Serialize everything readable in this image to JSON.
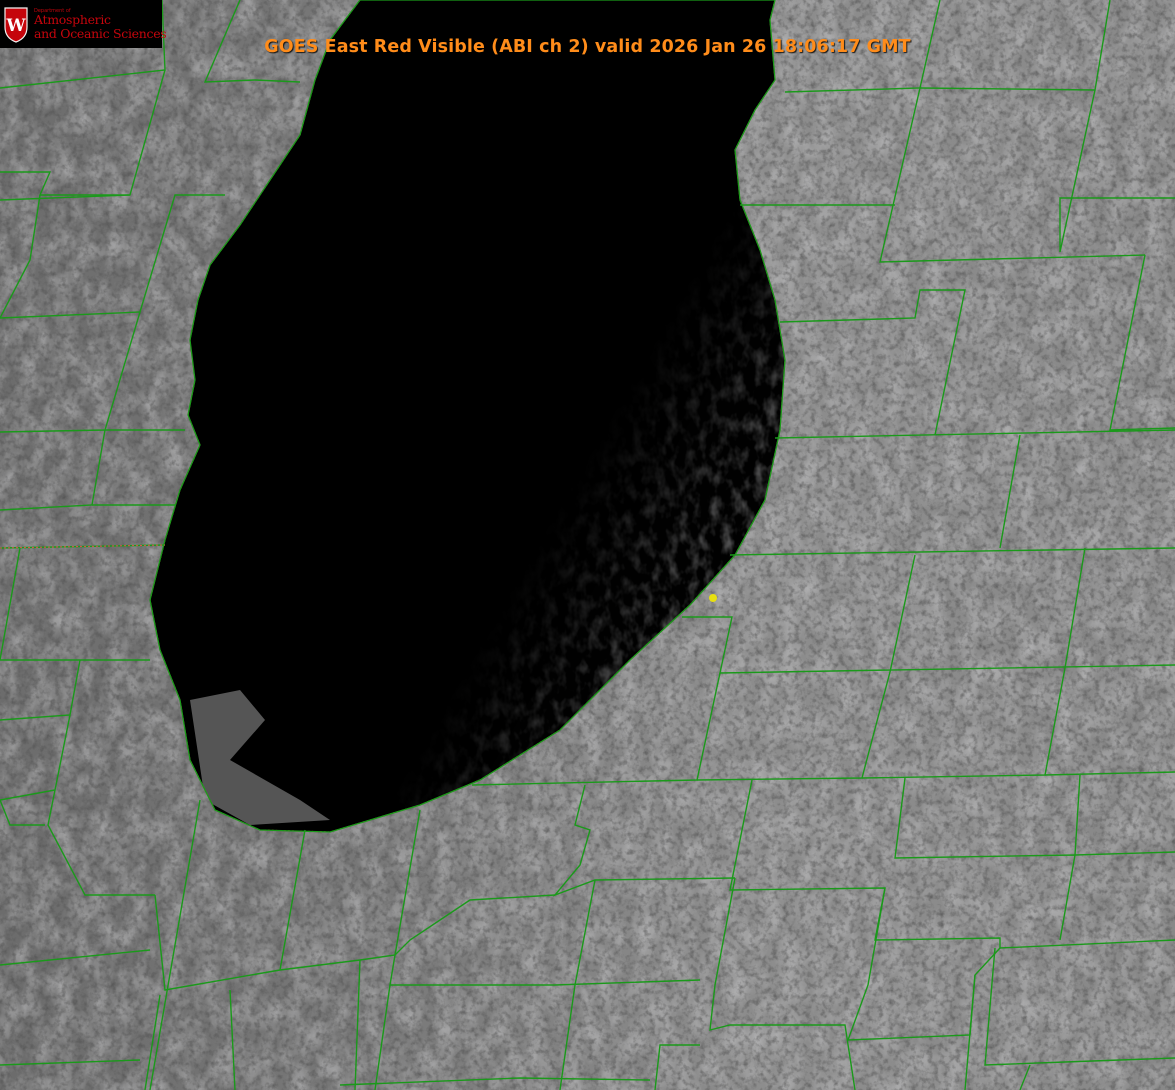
{
  "title": "GOES East Red Visible (ABI ch 2) valid 2026 Jan 26 18:06:17 GMT",
  "logo": {
    "department": "Department of",
    "line1": "Atmospheric",
    "line2": "and Oceanic Sciences",
    "crest_letter": "W"
  },
  "colors": {
    "title": "#ff8c1a",
    "logo_text": "#c5050c",
    "county_lines": "#1a9a1a",
    "shoreline": "#ff4a4a",
    "marker": "#e8e010",
    "lake": "#040404",
    "land": "#8a8a8a"
  },
  "icons": {
    "crest": "uw-crest-icon",
    "marker": "station-dot-icon"
  }
}
